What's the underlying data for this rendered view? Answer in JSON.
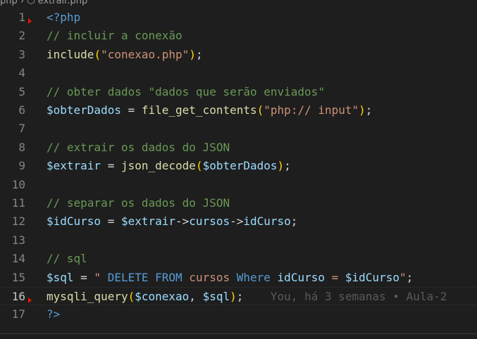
{
  "breadcrumb": {
    "text": "php  ›  ⬡ extrair.php"
  },
  "lines": [
    {
      "n": "1",
      "tokens": [
        [
          "tag",
          "<?php"
        ]
      ]
    },
    {
      "n": "2",
      "tokens": [
        [
          "cmt",
          "// incluir a conexão"
        ]
      ]
    },
    {
      "n": "3",
      "tokens": [
        [
          "fn",
          "include"
        ],
        [
          "br1",
          "("
        ],
        [
          "str",
          "\"conexao.php\""
        ],
        [
          "br1",
          ")"
        ],
        [
          "op",
          ";"
        ]
      ]
    },
    {
      "n": "4",
      "tokens": []
    },
    {
      "n": "5",
      "tokens": [
        [
          "cmt",
          "// obter dados \"dados que serão enviados\""
        ]
      ]
    },
    {
      "n": "6",
      "tokens": [
        [
          "var",
          "$obterDados"
        ],
        [
          "op",
          " = "
        ],
        [
          "fn",
          "file_get_contents"
        ],
        [
          "br1",
          "("
        ],
        [
          "str",
          "\"php:// input\""
        ],
        [
          "br1",
          ")"
        ],
        [
          "op",
          ";"
        ]
      ]
    },
    {
      "n": "7",
      "tokens": []
    },
    {
      "n": "8",
      "tokens": [
        [
          "cmt",
          "// extrair os dados do JSON"
        ]
      ]
    },
    {
      "n": "9",
      "tokens": [
        [
          "var",
          "$extrair"
        ],
        [
          "op",
          " = "
        ],
        [
          "fn",
          "json_decode"
        ],
        [
          "br1",
          "("
        ],
        [
          "var",
          "$obterDados"
        ],
        [
          "br1",
          ")"
        ],
        [
          "op",
          ";"
        ]
      ]
    },
    {
      "n": "10",
      "tokens": []
    },
    {
      "n": "11",
      "tokens": [
        [
          "cmt",
          "// separar os dados do JSON"
        ]
      ]
    },
    {
      "n": "12",
      "tokens": [
        [
          "var",
          "$idCurso"
        ],
        [
          "op",
          " = "
        ],
        [
          "var",
          "$extrair"
        ],
        [
          "op",
          "->"
        ],
        [
          "var",
          "cursos"
        ],
        [
          "op",
          "->"
        ],
        [
          "var",
          "idCurso"
        ],
        [
          "op",
          ";"
        ]
      ]
    },
    {
      "n": "13",
      "tokens": []
    },
    {
      "n": "14",
      "tokens": [
        [
          "cmt",
          "// sql"
        ]
      ]
    },
    {
      "n": "15",
      "tokens": [
        [
          "var",
          "$sql"
        ],
        [
          "op",
          " = "
        ],
        [
          "str",
          "\" "
        ],
        [
          "kw",
          "DELETE FROM"
        ],
        [
          "str",
          " cursos "
        ],
        [
          "kw",
          "Where"
        ],
        [
          "str",
          " "
        ],
        [
          "var",
          "idCurso"
        ],
        [
          "str",
          " = "
        ],
        [
          "var",
          "$idCurso"
        ],
        [
          "str",
          "\""
        ],
        [
          "op",
          ";"
        ]
      ]
    },
    {
      "n": "16",
      "tokens": [
        [
          "fn",
          "mysqli_query"
        ],
        [
          "br1",
          "("
        ],
        [
          "var",
          "$conexao"
        ],
        [
          "op",
          ", "
        ],
        [
          "var",
          "$sql"
        ],
        [
          "br1",
          ")"
        ],
        [
          "op",
          ";"
        ]
      ],
      "blame": "You, há 3 semanas • Aula-2"
    },
    {
      "n": "17",
      "tokens": [
        [
          "tag",
          "?>"
        ]
      ]
    }
  ]
}
